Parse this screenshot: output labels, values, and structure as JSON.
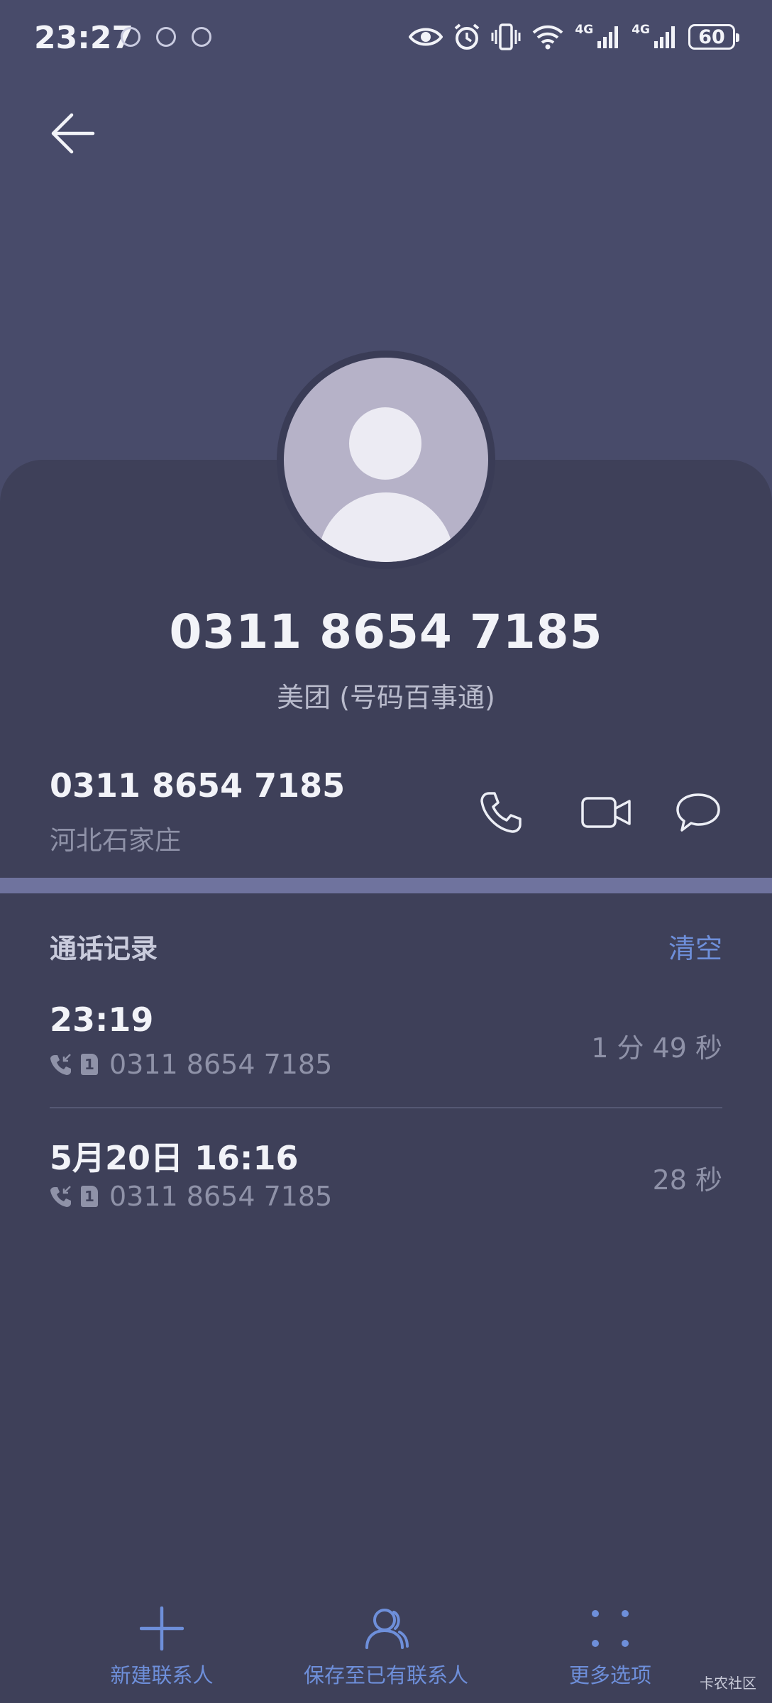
{
  "status_bar": {
    "time": "23:27",
    "battery": "60",
    "network_1": "4G",
    "network_2": "4G",
    "icons": [
      "notification-icon",
      "chat-icon",
      "notification-icon",
      "eye-icon",
      "alarm-icon",
      "vibrate-icon",
      "wifi-icon",
      "signal-icon",
      "signal-icon",
      "battery-icon"
    ]
  },
  "header": {
    "back_icon": "back-arrow-icon"
  },
  "caller": {
    "number": "0311 8654 7185",
    "tag": "美团 (号码百事通)"
  },
  "number_row": {
    "number": "0311 8654 7185",
    "location": "河北石家庄",
    "actions": [
      "phone-icon",
      "video-call-icon",
      "message-icon"
    ]
  },
  "history": {
    "title": "通话记录",
    "clear_label": "清空",
    "entries": [
      {
        "time": "23:19",
        "number": "0311 8654 7185",
        "duration": "1 分 49 秒",
        "sim": "1"
      },
      {
        "time": "5月20日 16:16",
        "number": "0311 8654 7185",
        "duration": "28 秒",
        "sim": "1"
      }
    ]
  },
  "bottom_bar": {
    "items": [
      {
        "label": "新建联系人",
        "icon": "plus-icon"
      },
      {
        "label": "保存至已有联系人",
        "icon": "contact-icon"
      },
      {
        "label": "更多选项",
        "icon": "more-icon"
      }
    ]
  },
  "watermark": "卡农社区",
  "colors": {
    "background": "#484b6a",
    "card": "#3e4059",
    "accent": "#6e8fda",
    "divider_band": "#6f739e"
  }
}
